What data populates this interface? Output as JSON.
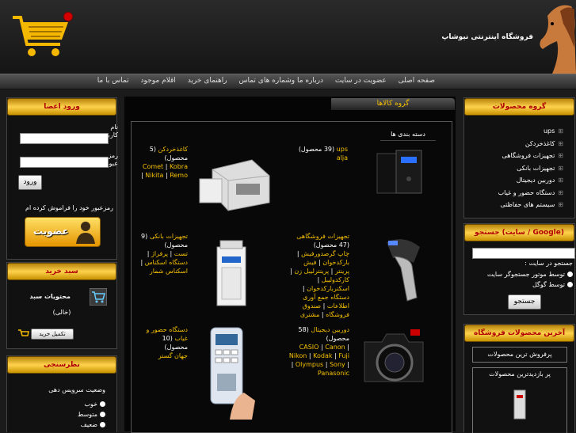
{
  "header": {
    "store_name": "فروشگاه اینترنتی نیوشاپ"
  },
  "nav": {
    "items": [
      "صفحه اصلی",
      "عضویت در سایت",
      "درباره ما وشماره های تماس",
      "راهنمای خرید",
      "اقلام موجود",
      "تماس با ما"
    ]
  },
  "login": {
    "title": "ورود اعضا",
    "side_text": [
      "نام",
      "کاربری",
      "رمز",
      "عبور"
    ],
    "login_button": "ورود",
    "forgot_text": "رمزعبور خود را فراموش کرده ام",
    "register_button": "عضویت"
  },
  "cart": {
    "title": "سبد خرید",
    "contents_label": "محتویات سبد",
    "empty_text": "(خالی)",
    "complete_button": "تکمیل خرید"
  },
  "poll": {
    "title": "نظرسنجی",
    "question": "وضعیت سرویس دهی",
    "options": [
      "خوب",
      "متوسط",
      "ضعیف"
    ]
  },
  "center": {
    "tab_title": "گروه کالاها",
    "section_label": "دسته بندی ها"
  },
  "products": [
    {
      "title": "ups",
      "count": "(39 محصول)",
      "links": [
        "alja"
      ]
    },
    {
      "title": "کاغذخردکن",
      "count": "(5 محصول)",
      "links": [
        "Comet",
        "Kobra",
        "Nikita",
        "Remo"
      ]
    },
    {
      "title": "تجهیزات فروشگاهی",
      "count": "(47 محصول)",
      "links": [
        "چاپ گرصدورفیش",
        "بارکدخوان",
        "فیش پرینتر",
        "پرینترلیبل زن",
        "کارکدولیبل",
        "اسکنربارکدخوان",
        "دستگاه جمع آوری اطلاعات",
        "صندوق فروشگاه",
        "مشتری"
      ]
    },
    {
      "title": "تجهیزات بانکی",
      "count": "(9 محصول)",
      "links": [
        "تست",
        "پرفراژ",
        "دستگاه اسکناس",
        "اسکناس شمار"
      ]
    },
    {
      "title": "دوربین دیجیتال",
      "count": "(58 محصول)",
      "links": [
        "CASIO",
        "Canon",
        "Nikon",
        "Kodak",
        "Fuji",
        "Olympus",
        "Sony",
        "Panasonic"
      ]
    },
    {
      "title": "دستگاه حضور و غیاب",
      "count": "(10 محصول)",
      "links": [
        "جهان گستر"
      ]
    }
  ],
  "groups": {
    "title": "گروه محصولات",
    "items": [
      "ups",
      "کاغذخردکن",
      "تجهیزات فروشگاهی",
      "تجهیزات بانکی",
      "دوربین دیجیتال",
      "دستگاه حضور و غیاب",
      "سیستم های حفاظتی"
    ]
  },
  "search": {
    "title": "جستجو (سایت / Google)",
    "in_site": "جستجو در سایت :",
    "opt_site": "توسط موتور جستجوگر سایت",
    "opt_google": "توسط گوگل",
    "button": "جستجو"
  },
  "latest": {
    "title": "آخرین محصولات فروشگاه",
    "best": "پرفروش ترین محصولات",
    "most_viewed": "پر بازدیدترین محصولات"
  }
}
